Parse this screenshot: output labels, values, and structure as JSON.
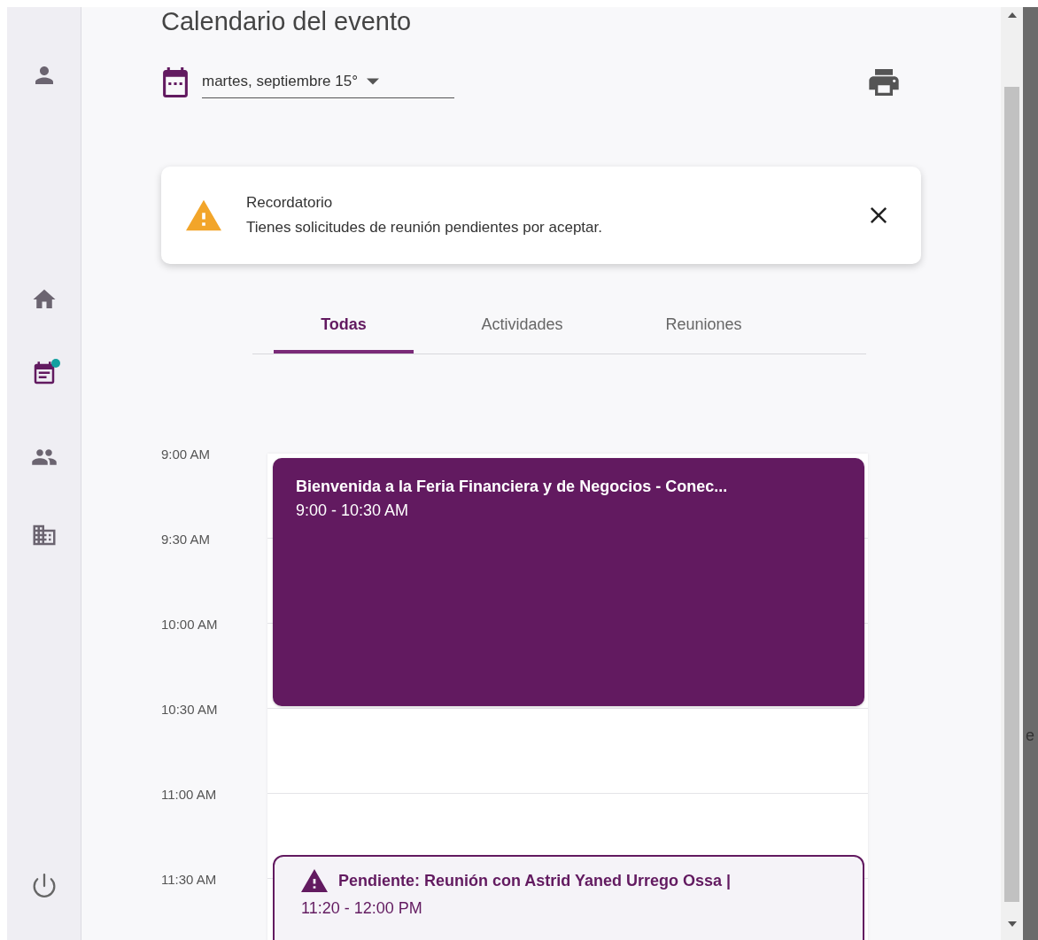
{
  "sidebar": {
    "items": [
      {
        "kind": "person",
        "selected": false
      },
      {
        "kind": "home",
        "selected": false
      },
      {
        "kind": "calendar",
        "selected": true,
        "badge": true
      },
      {
        "kind": "people",
        "selected": false
      },
      {
        "kind": "building",
        "selected": false
      }
    ]
  },
  "page_title": "Calendario del evento",
  "date_picker": {
    "value": "martes, septiembre 15°"
  },
  "alert": {
    "title": "Recordatorio",
    "message": "Tienes solicitudes de reunión pendientes por aceptar."
  },
  "tabs": [
    {
      "label": "Todas",
      "selected": true
    },
    {
      "label": "Actividades",
      "selected": false
    },
    {
      "label": "Reuniones",
      "selected": false
    }
  ],
  "time_slots": [
    "9:00 AM",
    "9:30 AM",
    "10:00 AM",
    "10:30 AM",
    "11:00 AM",
    "11:30 AM"
  ],
  "events": [
    {
      "kind": "activity",
      "title": "Bienvenida a la Feria Financiera y de Negocios - Conec...",
      "time": "9:00 - 10:30 AM"
    },
    {
      "kind": "pending_meeting",
      "title": "Pendiente: Reunión con Astrid Yaned Urrego Ossa |",
      "time": "11:20 - 12:00 PM"
    }
  ],
  "backdrop_text": "e"
}
